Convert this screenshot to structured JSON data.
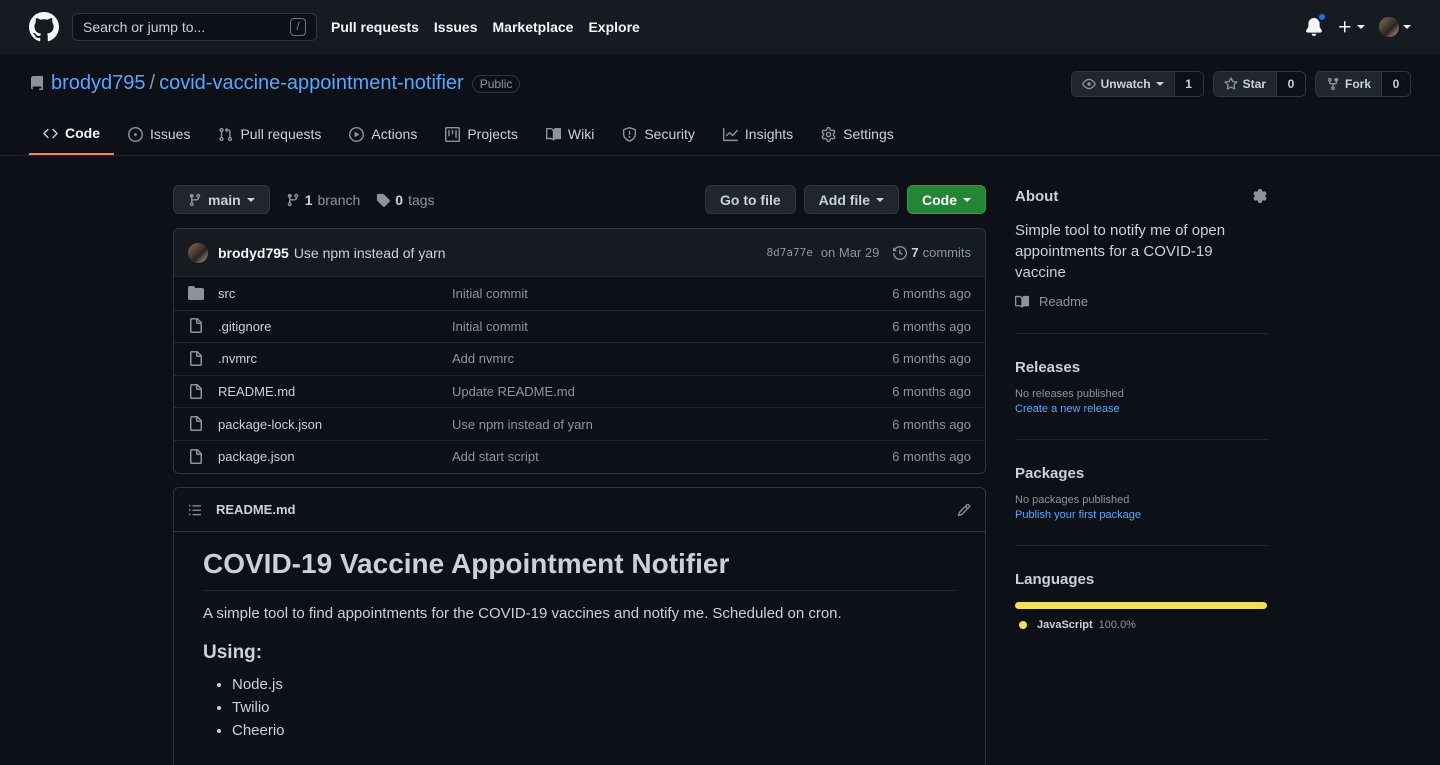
{
  "header": {
    "search_placeholder": "Search or jump to...",
    "search_key": "/",
    "nav": [
      "Pull requests",
      "Issues",
      "Marketplace",
      "Explore"
    ]
  },
  "repo": {
    "owner": "brodyd795",
    "separator": "/",
    "name": "covid-vaccine-appointment-notifier",
    "visibility": "Public",
    "unwatch_label": "Unwatch",
    "watch_count": "1",
    "star_label": "Star",
    "star_count": "0",
    "fork_label": "Fork",
    "fork_count": "0"
  },
  "tabs": [
    {
      "label": "Code",
      "icon": "code-icon",
      "active": true
    },
    {
      "label": "Issues",
      "icon": "issue-icon"
    },
    {
      "label": "Pull requests",
      "icon": "pull-request-icon"
    },
    {
      "label": "Actions",
      "icon": "play-icon"
    },
    {
      "label": "Projects",
      "icon": "project-icon"
    },
    {
      "label": "Wiki",
      "icon": "book-icon"
    },
    {
      "label": "Security",
      "icon": "shield-icon"
    },
    {
      "label": "Insights",
      "icon": "graph-icon"
    },
    {
      "label": "Settings",
      "icon": "gear-icon"
    }
  ],
  "filenav": {
    "branch": "main",
    "branch_count": "1",
    "branch_label": "branch",
    "tag_count": "0",
    "tag_label": "tags",
    "go_to_file": "Go to file",
    "add_file": "Add file",
    "code": "Code"
  },
  "commit": {
    "author": "brodyd795",
    "message": "Use npm instead of yarn",
    "sha": "8d7a77e",
    "date": "on Mar 29",
    "count": "7",
    "count_label": "commits"
  },
  "files": [
    {
      "name": "src",
      "type": "folder",
      "message": "Initial commit",
      "age": "6 months ago"
    },
    {
      "name": ".gitignore",
      "type": "file",
      "message": "Initial commit",
      "age": "6 months ago"
    },
    {
      "name": ".nvmrc",
      "type": "file",
      "message": "Add nvmrc",
      "age": "6 months ago"
    },
    {
      "name": "README.md",
      "type": "file",
      "message": "Update README.md",
      "age": "6 months ago"
    },
    {
      "name": "package-lock.json",
      "type": "file",
      "message": "Use npm instead of yarn",
      "age": "6 months ago"
    },
    {
      "name": "package.json",
      "type": "file",
      "message": "Add start script",
      "age": "6 months ago"
    }
  ],
  "readme": {
    "filename": "README.md",
    "title": "COVID-19 Vaccine Appointment Notifier",
    "description": "A simple tool to find appointments for the COVID-19 vaccines and notify me. Scheduled on cron.",
    "using_heading": "Using:",
    "using_items": [
      "Node.js",
      "Twilio",
      "Cheerio"
    ]
  },
  "sidebar": {
    "about_title": "About",
    "about_desc": "Simple tool to notify me of open appointments for a COVID-19 vaccine",
    "readme_label": "Readme",
    "releases_title": "Releases",
    "releases_none": "No releases published",
    "releases_link": "Create a new release",
    "packages_title": "Packages",
    "packages_none": "No packages published",
    "packages_link": "Publish your first package",
    "languages_title": "Languages",
    "languages": [
      {
        "name": "JavaScript",
        "percent": "100.0%",
        "color": "#f1e05a"
      }
    ]
  }
}
